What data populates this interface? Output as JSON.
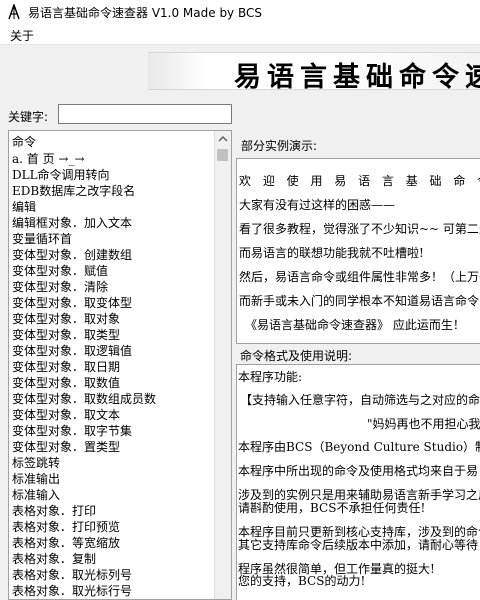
{
  "window": {
    "title": "易语言基础命令速查器 V1.0 Made by BCS"
  },
  "menu": {
    "about": "关于"
  },
  "banner": {
    "text": "易语言基础命令速查器"
  },
  "search": {
    "label": "关键字:",
    "value": "",
    "placeholder": ""
  },
  "command_list": {
    "header": "命令",
    "items": [
      "a. 首 页  →_→",
      "DLL命令调用转向",
      "EDB数据库之改字段名",
      "编辑",
      "编辑框对象．加入文本",
      "变量循环首",
      "变体型对象．创建数组",
      "变体型对象．赋值",
      "变体型对象．清除",
      "变体型对象．取变体型",
      "变体型对象．取对象",
      "变体型对象．取类型",
      "变体型对象．取逻辑值",
      "变体型对象．取日期",
      "变体型对象．取数值",
      "变体型对象．取数组成员数",
      "变体型对象．取文本",
      "变体型对象．取字节集",
      "变体型对象．置类型",
      "标签跳转",
      "标准输出",
      "标准输入",
      "表格对象．打印",
      "表格对象．打印预览",
      "表格对象．等宽缩放",
      "表格对象．复制",
      "表格对象．取光标列号",
      "表格对象．取光标行号"
    ]
  },
  "example": {
    "label": "部分实例演示:",
    "lines": [
      "欢 迎 使 用 易 语 言 基 础 命 令",
      "大家有没有过这样的困惑——",
      "看了很多教程，觉得涨了不少知识~~  可第二天",
      "而易语言的联想功能我就不吐槽啦!",
      "然后，易语言命令或组件属性非常多！（上万条",
      "而新手或未入门的同学根本不知道易语言命令的",
      "《易语言基础命令速查器》  应此运而生！"
    ]
  },
  "format": {
    "label": "命令格式及使用说明:",
    "lines": [
      "本程序功能:",
      "【支持输入任意字符，自动筛选与之对应的命令",
      "\"妈妈再也不用担心我",
      "本程序由BCS（Beyond Culture Studio）制作",
      "本程序中所出现的命令及使用格式均来自于易",
      "涉及到的实例只是用来辅助易语言新手学习之用",
      "请斟酌使用，BCS不承担任何责任!",
      "本程序目前只更新到核心支持库，涉及到的命令",
      "其它支持库命令后续版本中添加，请耐心等待",
      "程序虽然很简单，但工作量真的挺大!",
      "您的支持，BCS的动力!"
    ]
  }
}
